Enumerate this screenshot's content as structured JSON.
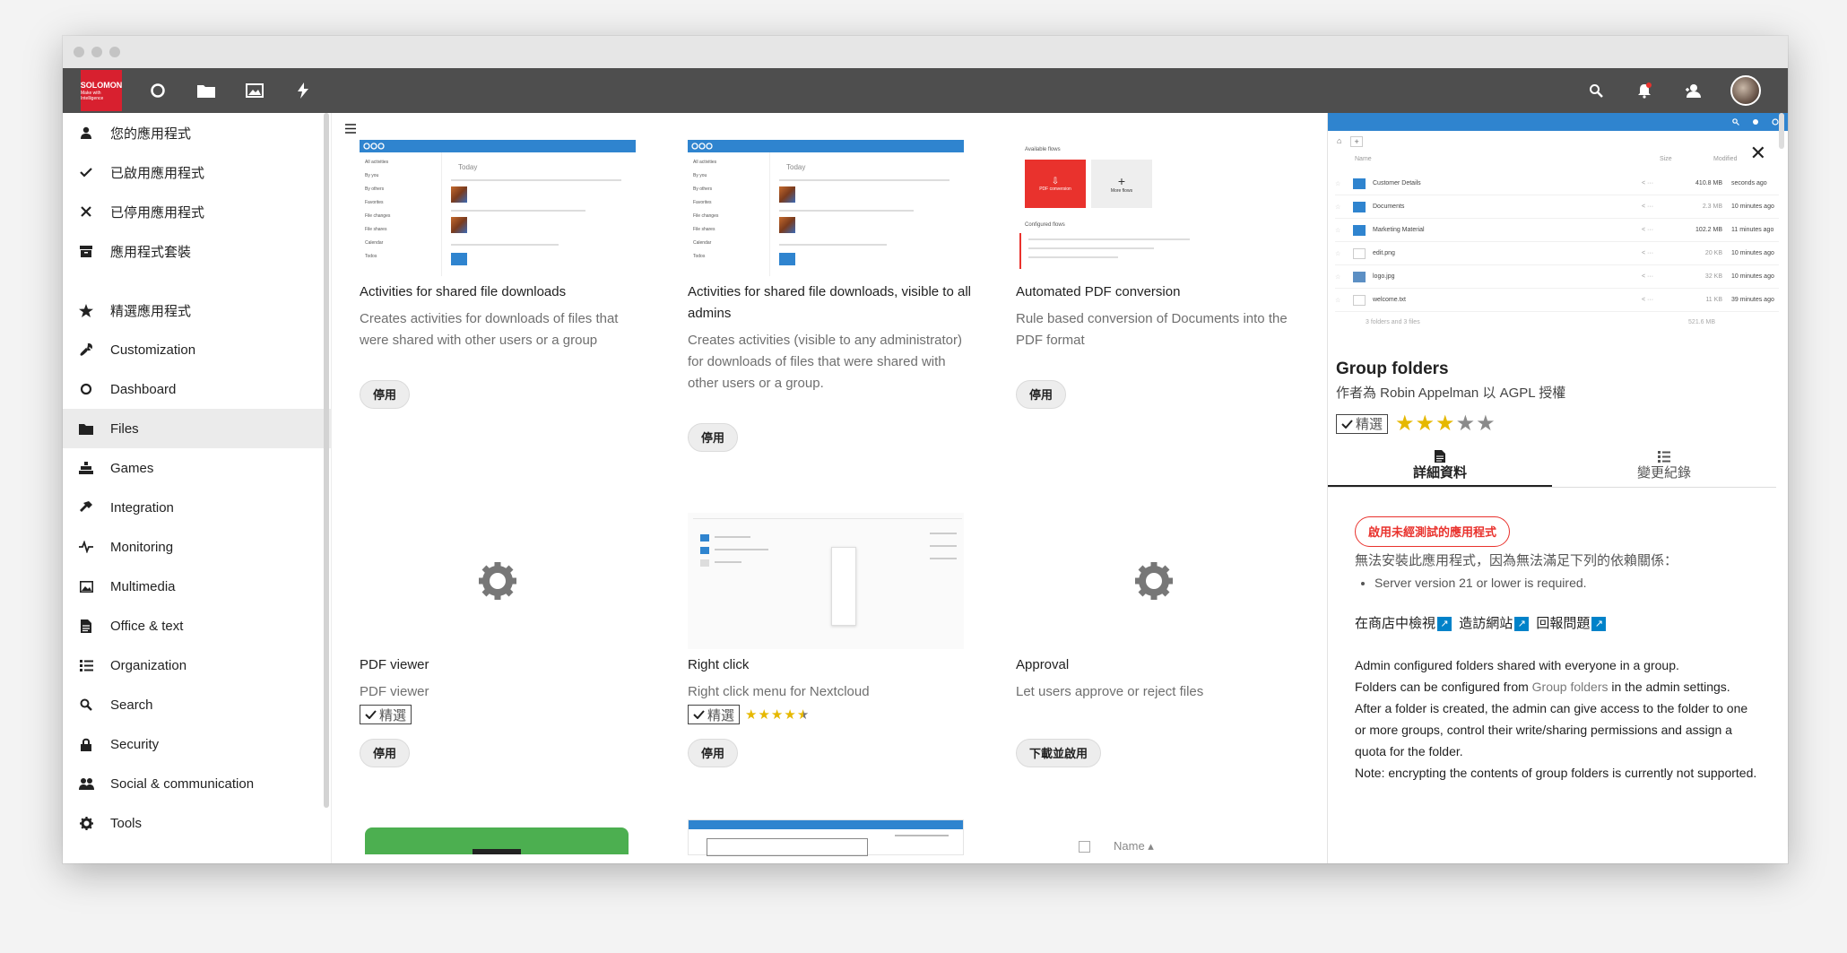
{
  "logo": {
    "line1": "SOLOMON",
    "line2": "Make with Intelligence"
  },
  "sidebar": {
    "items": [
      {
        "label": "您的應用程式"
      },
      {
        "label": "已啟用應用程式"
      },
      {
        "label": "已停用應用程式"
      },
      {
        "label": "應用程式套裝"
      },
      {
        "label": "精選應用程式"
      },
      {
        "label": "Customization"
      },
      {
        "label": "Dashboard"
      },
      {
        "label": "Files"
      },
      {
        "label": "Games"
      },
      {
        "label": "Integration"
      },
      {
        "label": "Monitoring"
      },
      {
        "label": "Multimedia"
      },
      {
        "label": "Office & text"
      },
      {
        "label": "Organization"
      },
      {
        "label": "Search"
      },
      {
        "label": "Security"
      },
      {
        "label": "Social & communication"
      },
      {
        "label": "Tools"
      }
    ]
  },
  "apps": [
    {
      "name": "Activities for shared file downloads",
      "desc": "Creates activities for downloads of files that were shared with other users or a group",
      "button": "停用"
    },
    {
      "name": "Activities for shared file downloads, visible to all admins",
      "desc": "Creates activities (visible to any administrator) for downloads of files that were shared with other users or a group.",
      "button": "停用"
    },
    {
      "name": "Automated PDF conversion",
      "desc": "Rule based conversion of Documents into the PDF format",
      "button": "停用"
    },
    {
      "name": "PDF viewer",
      "desc": "PDF viewer",
      "featured": "精選",
      "button": "停用"
    },
    {
      "name": "Right click",
      "desc": "Right click menu for Nextcloud",
      "featured": "精選",
      "rating": 4.5,
      "button": "停用"
    },
    {
      "name": "Approval",
      "desc": "Let users approve or reject files",
      "button": "下載並啟用"
    }
  ],
  "shots": {
    "activity_today": "Today",
    "activity_items": [
      "All activities",
      "By you",
      "By others",
      "Favorites",
      "File changes",
      "File shares",
      "Calendar",
      "Todos"
    ],
    "pdf_flows_title": "Available flows",
    "pdf_card1": "PDF conversion",
    "pdf_card2": "More flows",
    "pdf_configured": "Configured flows",
    "bottom_name_col": "Name"
  },
  "panel": {
    "title": "Group folders",
    "author": "作者為 Robin Appelman 以 AGPL 授權",
    "featured": "精選",
    "rating": 3,
    "tabs": [
      {
        "label": "詳細資料"
      },
      {
        "label": "變更紀錄"
      }
    ],
    "warn_button": "啟用未經測試的應用程式",
    "dep_text": "無法安裝此應用程式，因為無法滿足下列的依賴關係：",
    "dep_item": "Server version 21 or lower is required.",
    "links": [
      "在商店中檢視",
      "造訪網站",
      "回報問題"
    ],
    "desc1": "Admin configured folders shared with everyone in a group.",
    "desc2a": "Folders can be configured from ",
    "desc2link": "Group folders",
    "desc2b": " in the admin settings.",
    "desc3": "After a folder is created, the admin can give access to the folder to one or more groups, control their write/sharing permissions and assign a quota for the folder.",
    "desc4": "Note: encrypting the contents of group folders is currently not supported.",
    "files": {
      "header": [
        "Name",
        "Size",
        "Modified"
      ],
      "rows": [
        {
          "name": "Customer Details",
          "size": "410.8 MB",
          "mod": "seconds ago"
        },
        {
          "name": "Documents",
          "size": "2.3 MB",
          "mod": "10 minutes ago"
        },
        {
          "name": "Marketing Material",
          "size": "102.2 MB",
          "mod": "11 minutes ago"
        },
        {
          "name": "edit.png",
          "size": "20 KB",
          "mod": "10 minutes ago"
        },
        {
          "name": "logo.jpg",
          "size": "32 KB",
          "mod": "10 minutes ago"
        },
        {
          "name": "welcome.txt",
          "size": "11 KB",
          "mod": "39 minutes ago"
        }
      ],
      "summary": "3 folders and 3 files",
      "total": "521.6 MB"
    }
  },
  "colors": {
    "topbar": "#4e4e4e",
    "logo": "#d8202f",
    "accent": "#0082c9",
    "star": "#e6b800",
    "warn": "#e9322d"
  }
}
